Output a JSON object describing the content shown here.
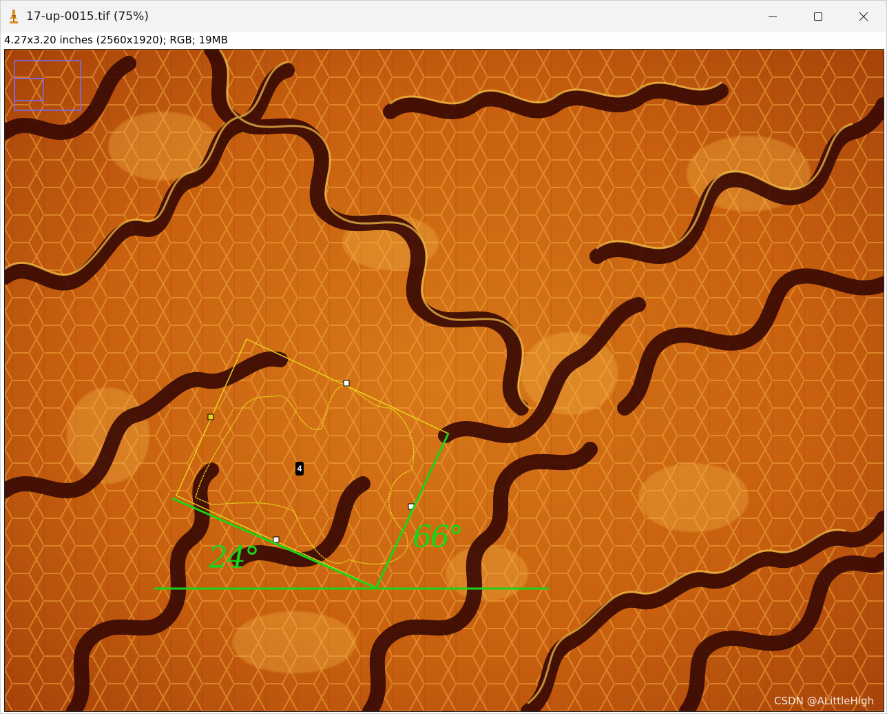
{
  "window": {
    "title": "17-up-0015.tif (75%)",
    "controls": [
      "minimize",
      "maximize",
      "close"
    ]
  },
  "info_bar": {
    "text": "4.27x3.20 inches (2560x1920); RGB; 19MB"
  },
  "overlay": {
    "roi_label": "4",
    "angle_left": "24°",
    "angle_right": "66°",
    "line_color": "#19d419",
    "roi_color": "#e8d21a",
    "navigator_color": "#7b6cff"
  },
  "watermark": "CSDN @ALittleHigh",
  "colors": {
    "title_bg": "#f3f3f3",
    "image_base": "#c45a0c",
    "vein_dark": "#3a0a04"
  }
}
